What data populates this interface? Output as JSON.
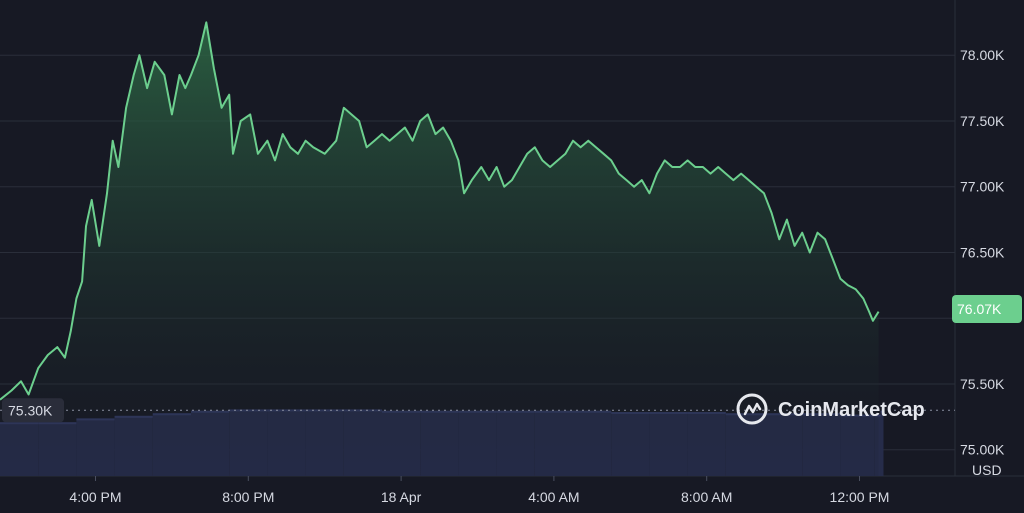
{
  "chart_data": {
    "type": "area",
    "title": "",
    "xlabel": "",
    "ylabel": "",
    "unit": "USD",
    "brand": "CoinMarketCap",
    "ylim": [
      74800,
      78420
    ],
    "y_ticks": [
      75000,
      75500,
      76000,
      76500,
      77000,
      77500,
      78000
    ],
    "y_tick_labels": [
      "75.00K",
      "75.50K",
      "",
      "76.50K",
      "77.00K",
      "77.50K",
      "78.00K"
    ],
    "x_ticks": [
      {
        "t": 2.5,
        "label": "4:00 PM"
      },
      {
        "t": 6.5,
        "label": "8:00 PM"
      },
      {
        "t": 10.5,
        "label": "18 Apr"
      },
      {
        "t": 14.5,
        "label": "4:00 AM"
      },
      {
        "t": 18.5,
        "label": "8:00 AM"
      },
      {
        "t": 22.5,
        "label": "12:00 PM"
      }
    ],
    "xlim": [
      0,
      25
    ],
    "reference_price": 75300,
    "reference_label": "75.30K",
    "current_price": 76070,
    "current_label": "76.07K",
    "series": [
      {
        "type": "line",
        "points": [
          [
            0.0,
            75380
          ],
          [
            0.3,
            75450
          ],
          [
            0.55,
            75520
          ],
          [
            0.75,
            75420
          ],
          [
            1.0,
            75620
          ],
          [
            1.25,
            75720
          ],
          [
            1.5,
            75780
          ],
          [
            1.7,
            75700
          ],
          [
            1.85,
            75900
          ],
          [
            2.0,
            76150
          ],
          [
            2.15,
            76280
          ],
          [
            2.25,
            76700
          ],
          [
            2.4,
            76900
          ],
          [
            2.6,
            76550
          ],
          [
            2.8,
            76950
          ],
          [
            2.95,
            77350
          ],
          [
            3.1,
            77150
          ],
          [
            3.3,
            77600
          ],
          [
            3.5,
            77850
          ],
          [
            3.65,
            78000
          ],
          [
            3.85,
            77750
          ],
          [
            4.05,
            77950
          ],
          [
            4.3,
            77850
          ],
          [
            4.5,
            77550
          ],
          [
            4.7,
            77850
          ],
          [
            4.85,
            77750
          ],
          [
            5.0,
            77850
          ],
          [
            5.2,
            78000
          ],
          [
            5.4,
            78250
          ],
          [
            5.6,
            77900
          ],
          [
            5.8,
            77600
          ],
          [
            6.0,
            77700
          ],
          [
            6.1,
            77250
          ],
          [
            6.3,
            77500
          ],
          [
            6.55,
            77550
          ],
          [
            6.75,
            77250
          ],
          [
            7.0,
            77350
          ],
          [
            7.2,
            77200
          ],
          [
            7.4,
            77400
          ],
          [
            7.6,
            77300
          ],
          [
            7.8,
            77250
          ],
          [
            8.0,
            77350
          ],
          [
            8.2,
            77300
          ],
          [
            8.5,
            77250
          ],
          [
            8.8,
            77350
          ],
          [
            9.0,
            77600
          ],
          [
            9.2,
            77550
          ],
          [
            9.4,
            77500
          ],
          [
            9.6,
            77300
          ],
          [
            9.8,
            77350
          ],
          [
            10.0,
            77400
          ],
          [
            10.2,
            77350
          ],
          [
            10.4,
            77400
          ],
          [
            10.6,
            77450
          ],
          [
            10.8,
            77350
          ],
          [
            11.0,
            77500
          ],
          [
            11.2,
            77550
          ],
          [
            11.4,
            77400
          ],
          [
            11.6,
            77450
          ],
          [
            11.8,
            77350
          ],
          [
            12.0,
            77200
          ],
          [
            12.15,
            76950
          ],
          [
            12.35,
            77050
          ],
          [
            12.6,
            77150
          ],
          [
            12.8,
            77050
          ],
          [
            13.0,
            77150
          ],
          [
            13.2,
            77000
          ],
          [
            13.4,
            77050
          ],
          [
            13.6,
            77150
          ],
          [
            13.8,
            77250
          ],
          [
            14.0,
            77300
          ],
          [
            14.2,
            77200
          ],
          [
            14.4,
            77150
          ],
          [
            14.6,
            77200
          ],
          [
            14.8,
            77250
          ],
          [
            15.0,
            77350
          ],
          [
            15.2,
            77300
          ],
          [
            15.4,
            77350
          ],
          [
            15.6,
            77300
          ],
          [
            15.8,
            77250
          ],
          [
            16.0,
            77200
          ],
          [
            16.2,
            77100
          ],
          [
            16.4,
            77050
          ],
          [
            16.6,
            77000
          ],
          [
            16.8,
            77050
          ],
          [
            17.0,
            76950
          ],
          [
            17.2,
            77100
          ],
          [
            17.4,
            77200
          ],
          [
            17.6,
            77150
          ],
          [
            17.8,
            77150
          ],
          [
            18.0,
            77200
          ],
          [
            18.2,
            77150
          ],
          [
            18.4,
            77150
          ],
          [
            18.6,
            77100
          ],
          [
            18.8,
            77150
          ],
          [
            19.0,
            77100
          ],
          [
            19.2,
            77050
          ],
          [
            19.4,
            77100
          ],
          [
            19.6,
            77050
          ],
          [
            19.8,
            77000
          ],
          [
            20.0,
            76950
          ],
          [
            20.2,
            76800
          ],
          [
            20.4,
            76600
          ],
          [
            20.6,
            76750
          ],
          [
            20.8,
            76550
          ],
          [
            21.0,
            76650
          ],
          [
            21.2,
            76500
          ],
          [
            21.4,
            76650
          ],
          [
            21.6,
            76600
          ],
          [
            21.8,
            76450
          ],
          [
            22.0,
            76300
          ],
          [
            22.2,
            76250
          ],
          [
            22.4,
            76220
          ],
          [
            22.6,
            76150
          ],
          [
            22.75,
            76050
          ],
          [
            22.85,
            75980
          ],
          [
            23.0,
            76050
          ]
        ]
      },
      {
        "type": "bar",
        "name": "volume",
        "points": [
          [
            0.0,
            0.42
          ],
          [
            1.0,
            0.42
          ],
          [
            2.0,
            0.45
          ],
          [
            3.0,
            0.47
          ],
          [
            4.0,
            0.49
          ],
          [
            5.0,
            0.51
          ],
          [
            6.0,
            0.52
          ],
          [
            7.0,
            0.52
          ],
          [
            8.0,
            0.52
          ],
          [
            9.0,
            0.52
          ],
          [
            10.0,
            0.51
          ],
          [
            11.0,
            0.51
          ],
          [
            12.0,
            0.51
          ],
          [
            13.0,
            0.51
          ],
          [
            14.0,
            0.51
          ],
          [
            15.0,
            0.51
          ],
          [
            16.0,
            0.5
          ],
          [
            17.0,
            0.5
          ],
          [
            18.0,
            0.5
          ],
          [
            19.0,
            0.49
          ],
          [
            20.0,
            0.49
          ],
          [
            21.0,
            0.49
          ],
          [
            22.0,
            0.48
          ],
          [
            22.9,
            0.48
          ],
          [
            23.05,
            0.51
          ]
        ]
      }
    ],
    "colors": {
      "background": "#171924",
      "line": "#6ccf8e",
      "area_top": "#2e6b46",
      "volume": "#262c4a",
      "volume_top": "#323963",
      "grid": "#2a2e3a",
      "badge": "#6ccf8e"
    }
  }
}
